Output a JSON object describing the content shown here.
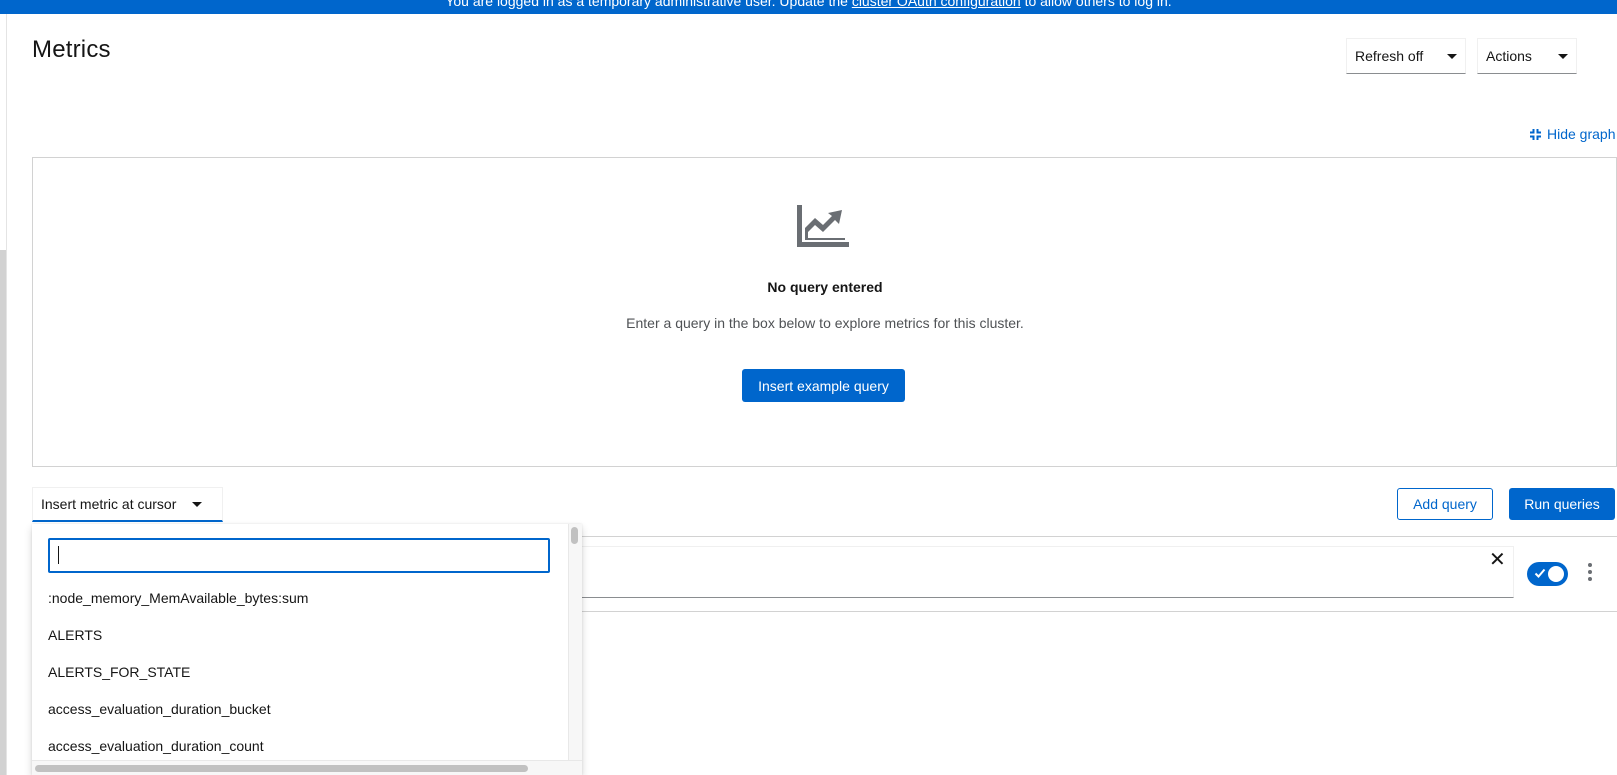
{
  "banner": {
    "text_before": "You are logged in as a temporary administrative user. Update the ",
    "link": "cluster OAuth configuration",
    "text_after": " to allow others to log in."
  },
  "page": {
    "title": "Metrics",
    "refresh_label": "Refresh off",
    "actions_label": "Actions",
    "hide_graph_label": "Hide graph"
  },
  "empty_state": {
    "title": "No query entered",
    "body": "Enter a query in the box below to explore metrics for this cluster.",
    "button": "Insert example query"
  },
  "toolbar": {
    "insert_metric_label": "Insert metric at cursor",
    "add_query": "Add query",
    "run_queries": "Run queries"
  },
  "query": {
    "value": "",
    "enabled": true
  },
  "metric_menu": {
    "search_value": "",
    "items": [
      ":node_memory_MemAvailable_bytes:sum",
      "ALERTS",
      "ALERTS_FOR_STATE",
      "access_evaluation_duration_bucket",
      "access_evaluation_duration_count"
    ]
  },
  "colors": {
    "accent": "#0066cc",
    "icon_gray": "#6a6e73"
  }
}
